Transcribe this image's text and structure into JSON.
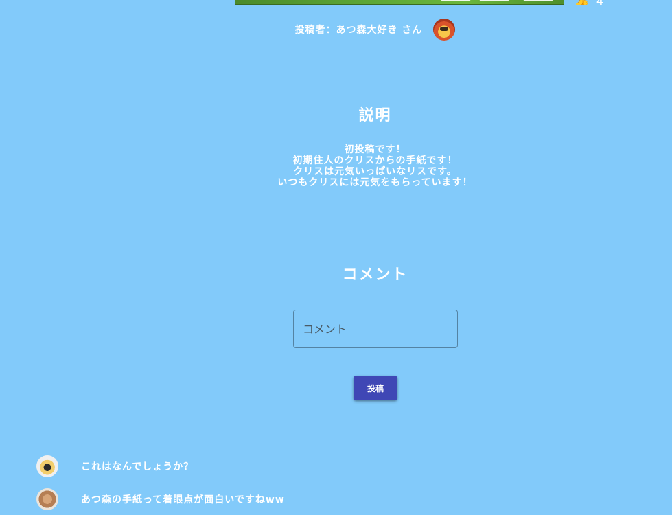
{
  "post": {
    "like_icon": "thumbs-up-icon",
    "like_count": "4",
    "poster_label": "投稿者：あつ森大好き さん"
  },
  "description": {
    "title": "説明",
    "lines": [
      "初投稿です！",
      "初期住人のクリスからの手紙です！",
      "クリスは元気いっぱいなリスです。",
      "いつもクリスには元気をもらっています！"
    ]
  },
  "comments": {
    "title": "コメント",
    "input_placeholder": "コメント",
    "input_value": "",
    "submit_label": "投稿",
    "submit_color": "#3f47b5",
    "items": [
      {
        "text": "これはなんでしょうか？"
      },
      {
        "text": "あつ森の手紙って着眼点が面白いですねww"
      }
    ]
  },
  "theme": {
    "background": "#82cafa",
    "text": "#ffffff"
  }
}
